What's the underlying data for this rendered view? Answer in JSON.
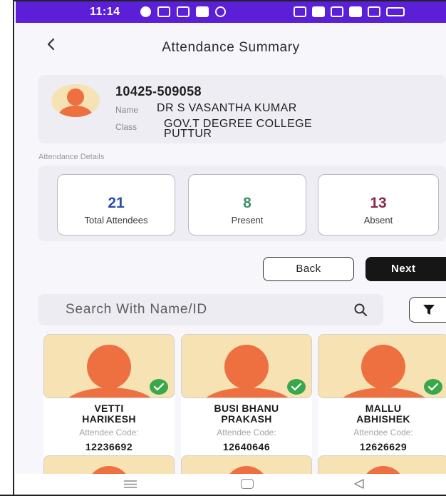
{
  "status_bar": {
    "time": "11:14"
  },
  "header": {
    "title": "Attendance Summary"
  },
  "profile": {
    "code": "10425-509058",
    "name_label": "Name",
    "name": "DR S VASANTHA KUMAR",
    "class_label": "Class",
    "class_line1": "GOV.T DEGREE COLLEGE",
    "class_line2": "PUTTUR"
  },
  "attendance": {
    "section_label": "Attendance Details",
    "stats": [
      {
        "value": "21",
        "label": "Total Attendees",
        "color": "#2a4fa8"
      },
      {
        "value": "8",
        "label": "Present",
        "color": "#3f8f6a"
      },
      {
        "value": "13",
        "label": "Absent",
        "color": "#8a2748"
      }
    ]
  },
  "actions": {
    "back_label": "Back",
    "next_label": "Next"
  },
  "search": {
    "placeholder": "Search With Name/ID"
  },
  "attendees": [
    {
      "name_line1": "VETTI",
      "name_line2": "HARIKESH",
      "code_label": "Attendee Code:",
      "code": "12236692",
      "present": true
    },
    {
      "name_line1": "BUSI BHANU",
      "name_line2": "PRAKASH",
      "code_label": "Attendee Code:",
      "code": "12640646",
      "present": true
    },
    {
      "name_line1": "MALLU",
      "name_line2": "ABHISHEK",
      "code_label": "Attendee Code:",
      "code": "12626629",
      "present": true
    }
  ],
  "colors": {
    "status_bar": "#5a1fd6",
    "avatar_bg": "#f7e2b4",
    "avatar_fg": "#ee7041",
    "check": "#3aa84a",
    "primary_button": "#161616"
  },
  "icons": [
    "back-arrow-icon",
    "search-icon",
    "filter-icon",
    "check-icon",
    "nav-menu-icon",
    "nav-home-icon",
    "nav-back-icon"
  ]
}
